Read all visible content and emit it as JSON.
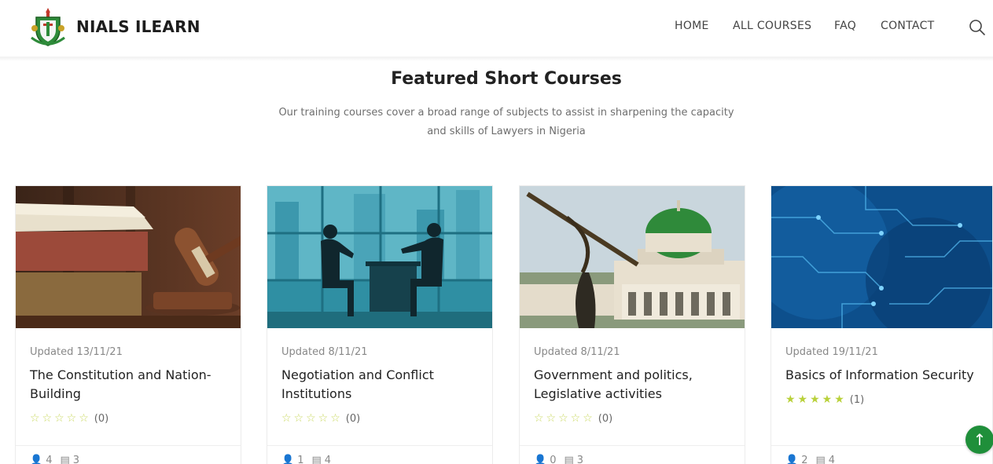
{
  "brand": {
    "name": "NIALS ILEARN",
    "logo_icon": "nials-crest-icon"
  },
  "nav": {
    "items": [
      "HOME",
      "ALL COURSES",
      "FAQ",
      "CONTACT"
    ],
    "search_icon": "search-icon"
  },
  "section": {
    "title": "Featured Short Courses",
    "subtitle_line1": "Our training courses cover a broad range of subjects to assist in sharpening the capacity",
    "subtitle_line2": "and skills of Lawyers in Nigeria"
  },
  "courses": [
    {
      "updated": "Updated 13/11/21",
      "title": "The Constitution and Nation-Building",
      "rating_count": "(0)",
      "rating": 0,
      "students": "4",
      "lessons": "3",
      "image": "law-books-gavel-image"
    },
    {
      "updated": "Updated 8/11/21",
      "title": "Negotiation and Conflict Institutions",
      "rating_count": "(0)",
      "rating": 0,
      "students": "1",
      "lessons": "4",
      "image": "negotiation-silhouettes-image"
    },
    {
      "updated": "Updated 8/11/21",
      "title": "Government and politics, Legislative activities",
      "rating_count": "(0)",
      "rating": 0,
      "students": "0",
      "lessons": "3",
      "image": "national-assembly-image"
    },
    {
      "updated": "Updated 19/11/21",
      "title": "Basics of Information Security",
      "rating_count": "(1)",
      "rating": 5,
      "students": "2",
      "lessons": "4",
      "image": "circuit-board-globe-image"
    }
  ],
  "colors": {
    "accent_green": "#1f8f3a",
    "star_color": "#b9d13a"
  },
  "back_to_top": {
    "label": "↑",
    "icon": "arrow-up-icon"
  }
}
